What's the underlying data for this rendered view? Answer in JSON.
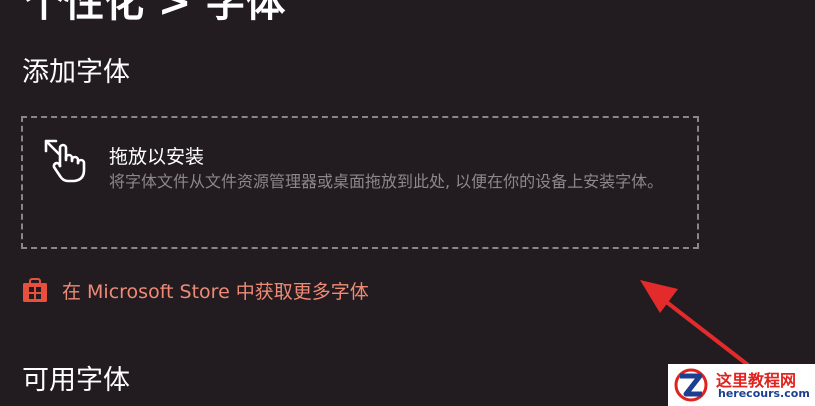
{
  "page": {
    "title": "个性化 > 字体"
  },
  "add_fonts": {
    "title": "添加字体",
    "dropzone": {
      "icon": "drag-hand-icon",
      "title": "拖放以安装",
      "description": "将字体文件从文件资源管理器或桌面拖放到此处, 以便在你的设备上安装字体。"
    },
    "store_link": {
      "icon": "store-bag-icon",
      "label": "在 Microsoft Store 中获取更多字体"
    }
  },
  "available_fonts": {
    "title": "可用字体"
  },
  "watermark": {
    "title": "这里教程网",
    "url": "herecours.com"
  },
  "colors": {
    "background": "#221c20",
    "link": "#ee8a76",
    "store_icon": "#e7503c",
    "arrow": "#e32b2b",
    "watermark_red": "#e0231f",
    "watermark_blue": "#1c3f91"
  }
}
